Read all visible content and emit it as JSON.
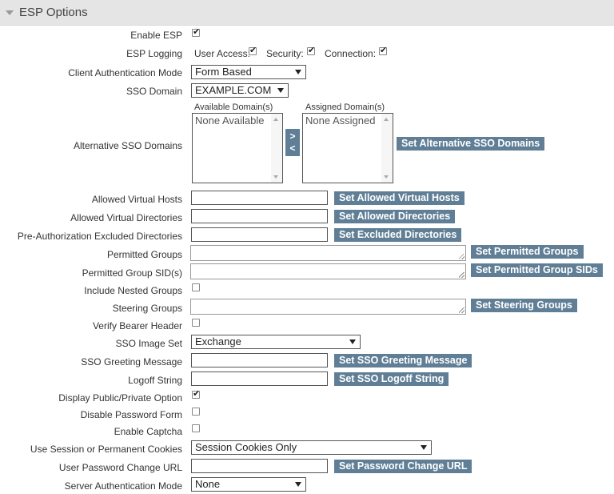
{
  "section": {
    "title": "ESP Options"
  },
  "labels": {
    "enable_esp": "Enable ESP",
    "esp_logging": "ESP Logging",
    "client_auth_mode": "Client Authentication Mode",
    "sso_domain": "SSO Domain",
    "alt_sso_domains": "Alternative SSO Domains",
    "allowed_virtual_hosts": "Allowed Virtual Hosts",
    "allowed_virtual_dirs": "Allowed Virtual Directories",
    "preauth_excluded_dirs": "Pre-Authorization Excluded Directories",
    "permitted_groups": "Permitted Groups",
    "permitted_group_sids": "Permitted Group SID(s)",
    "include_nested_groups": "Include Nested Groups",
    "steering_groups": "Steering Groups",
    "verify_bearer_header": "Verify Bearer Header",
    "sso_image_set": "SSO Image Set",
    "sso_greeting_message": "SSO Greeting Message",
    "logoff_string": "Logoff String",
    "display_public_private": "Display Public/Private Option",
    "disable_password_form": "Disable Password Form",
    "enable_captcha": "Enable Captcha",
    "session_cookies": "Use Session or Permanent Cookies",
    "user_password_change_url": "User Password Change URL",
    "server_auth_mode": "Server Authentication Mode"
  },
  "logging": {
    "user_access": "User Access:",
    "security": "Security:",
    "connection": "Connection:"
  },
  "selects": {
    "client_auth_mode": "Form Based",
    "sso_domain": "EXAMPLE.COM",
    "sso_image_set": "Exchange",
    "session_cookies": "Session Cookies Only",
    "server_auth_mode": "None"
  },
  "domains": {
    "available_label": "Available Domain(s)",
    "assigned_label": "Assigned Domain(s)",
    "available_item": "None Available",
    "assigned_item": "None Assigned",
    "move_right": ">",
    "move_left": "<"
  },
  "buttons": {
    "set_alt_sso": "Set Alternative SSO Domains",
    "set_allowed_hosts": "Set Allowed Virtual Hosts",
    "set_allowed_dirs": "Set Allowed Directories",
    "set_excluded_dirs": "Set Excluded Directories",
    "set_permitted_groups": "Set Permitted Groups",
    "set_permitted_sids": "Set Permitted Group SIDs",
    "set_steering_groups": "Set Steering Groups",
    "set_greeting": "Set SSO Greeting Message",
    "set_logoff": "Set SSO Logoff String",
    "set_password_url": "Set Password Change URL"
  },
  "checkboxes": {
    "enable_esp": true,
    "log_user_access": true,
    "log_security": true,
    "log_connection": true,
    "include_nested_groups": false,
    "verify_bearer_header": false,
    "display_public_private": true,
    "disable_password_form": false,
    "enable_captcha": false
  },
  "colors": {
    "button": "#607f96",
    "header": "#e5e5e5"
  }
}
